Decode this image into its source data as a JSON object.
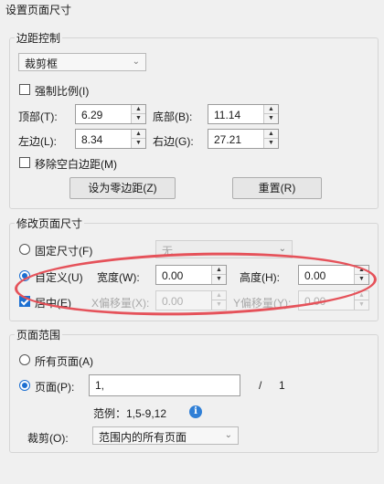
{
  "dialog": {
    "title": "设置页面尺寸"
  },
  "margins": {
    "group_label": "边距控制",
    "box_select": "裁剪框",
    "constrain_label": "强制比例(I)",
    "top_label": "顶部(T):",
    "top_value": "6.29",
    "bottom_label": "底部(B):",
    "bottom_value": "11.14",
    "left_label": "左边(L):",
    "left_value": "8.34",
    "right_label": "右边(G):",
    "right_value": "27.21",
    "remove_white_label": "移除空白边距(M)",
    "set_zero_button": "设为零边距(Z)",
    "reset_button": "重置(R)"
  },
  "page_size": {
    "group_label": "修改页面尺寸",
    "fixed_label": "固定尺寸(F)",
    "fixed_select": "无",
    "custom_label": "自定义(U)",
    "width_label": "宽度(W):",
    "width_value": "0.00",
    "height_label": "高度(H):",
    "height_value": "0.00",
    "center_label": "居中(E)",
    "x_offset_label": "X偏移量(X):",
    "x_offset_value": "0.00",
    "y_offset_label": "Y偏移量(Y):",
    "y_offset_value": "0.00"
  },
  "page_range": {
    "group_label": "页面范围",
    "all_pages_label": "所有页面(A)",
    "pages_label": "页面(P):",
    "pages_value": "1,",
    "separator": "/",
    "total_pages": "1",
    "example_text": "范例：1,5-9,12",
    "crop_label": "裁剪(O):",
    "crop_select": "范围内的所有页面"
  },
  "annotation": {
    "color": "#e5525a"
  }
}
